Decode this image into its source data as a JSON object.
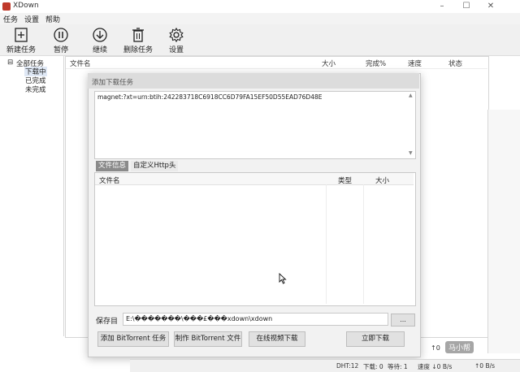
{
  "window": {
    "title": "XDown"
  },
  "menu": {
    "items": [
      "任务",
      "设置",
      "帮助"
    ]
  },
  "toolbar": {
    "new_task": "新建任务",
    "pause": "暂停",
    "resume": "继续",
    "delete_task": "删除任务",
    "settings": "设置"
  },
  "tree": {
    "root": "全部任务",
    "downloading": "下载中",
    "completed": "已完成",
    "incomplete": "未完成"
  },
  "list_columns": {
    "filename": "文件名",
    "size": "大小",
    "progress": "完成%",
    "speed": "速度",
    "status": "状态"
  },
  "dialog": {
    "title": "添加下载任务",
    "magnet": "magnet:?xt=urn:btih:242283718C6918CC6D79FA15EF50D55EAD76D48E",
    "tabs": [
      "文件信息",
      "自定义Http头"
    ],
    "file_columns": {
      "filename": "文件名",
      "type": "类型",
      "size": "大小"
    },
    "save_dir_label": "保存目",
    "save_dir_value": "E:\\�������\\���£���xdown\\xdown",
    "browse": "...",
    "buttons": {
      "add_bt": "添加 BitTorrent 任务",
      "make_bt": "制作 BitTorrent 文件",
      "online_video": "在线视频下载",
      "download_now": "立即下载"
    }
  },
  "statusbar": {
    "dht": "DHT:12",
    "downloading": "下载: 0",
    "waiting": "等待: 1",
    "down_speed": "速度 ↓0 B/s",
    "up_speed": "↑0 B/s"
  },
  "side_text": "↑0",
  "watermark": "马小帮"
}
